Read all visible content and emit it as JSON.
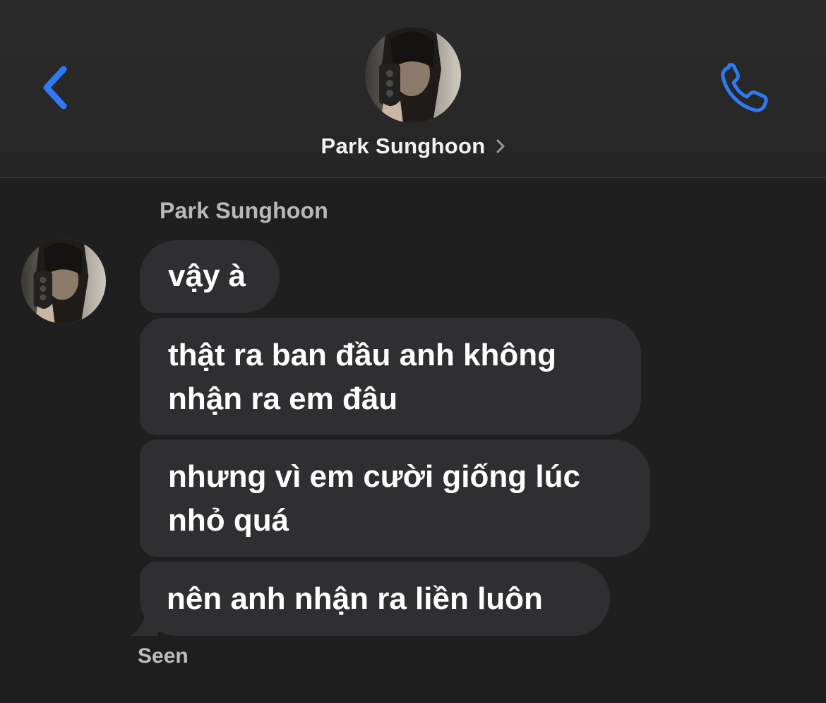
{
  "header": {
    "contact_name": "Park Sunghoon"
  },
  "thread": {
    "sender_label": "Park Sunghoon",
    "messages": [
      {
        "text": "vậy à"
      },
      {
        "line1": "thật ra ban đầu anh không",
        "line2": "nhận ra em đâu"
      },
      {
        "line1": "nhưng vì em cười giống lúc",
        "line2": "nhỏ quá"
      },
      {
        "text": "nên anh nhận ra liền luôn"
      }
    ],
    "status": "Seen"
  },
  "icons": {
    "back": "chevron-left-icon",
    "call": "phone-icon",
    "name_chevron": "chevron-right-icon"
  },
  "colors": {
    "accent": "#2f7bf5",
    "bubble": "#2f2f31",
    "background": "#1f1f1f"
  }
}
